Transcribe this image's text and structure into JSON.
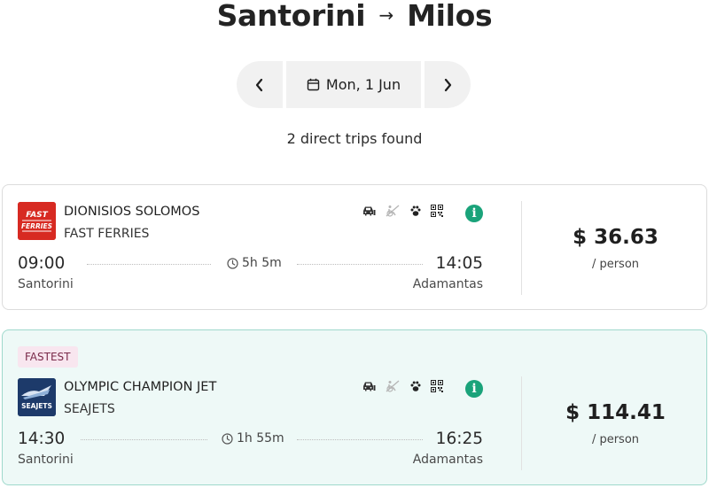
{
  "header": {
    "origin": "Santorini",
    "arrow": "→",
    "destination": "Milos"
  },
  "date_nav": {
    "date_label": "Mon, 1 Jun",
    "prev_icon": "chevron-left-icon",
    "next_icon": "chevron-right-icon"
  },
  "results": {
    "count_text": "2 direct trips found"
  },
  "trips": [
    {
      "badge": "",
      "vessel": "DIONISIOS SOLOMOS",
      "company": "FAST FERRIES",
      "logo_text_line1": "FAST",
      "logo_text_line2": "FERRIES",
      "departure_time": "09:00",
      "arrival_time": "14:05",
      "duration": "5h 5m",
      "departure_port": "Santorini",
      "arrival_port": "Adamantas",
      "price": "$ 36.63",
      "price_unit": "/ person",
      "amenities": [
        "car-icon",
        "no-wheelchair-icon",
        "pet-icon",
        "qr-code-icon"
      ]
    },
    {
      "badge": "FASTEST",
      "vessel": "OLYMPIC CHAMPION JET",
      "company": "SEAJETS",
      "logo_text_line1": "SEAJETS",
      "departure_time": "14:30",
      "arrival_time": "16:25",
      "duration": "1h 55m",
      "departure_port": "Santorini",
      "arrival_port": "Adamantas",
      "price": "$ 114.41",
      "price_unit": "/ person",
      "amenities": [
        "car-icon",
        "no-wheelchair-icon",
        "pet-icon",
        "qr-code-icon"
      ]
    }
  ],
  "colors": {
    "info_green": "#1aa37a",
    "fastest_card_bg": "#eef9f7",
    "fastest_card_border": "#9fd9cc",
    "badge_bg": "#f8e6ef",
    "fast_ferries_red": "#d72a22",
    "seajets_navy": "#1d3a6a"
  }
}
